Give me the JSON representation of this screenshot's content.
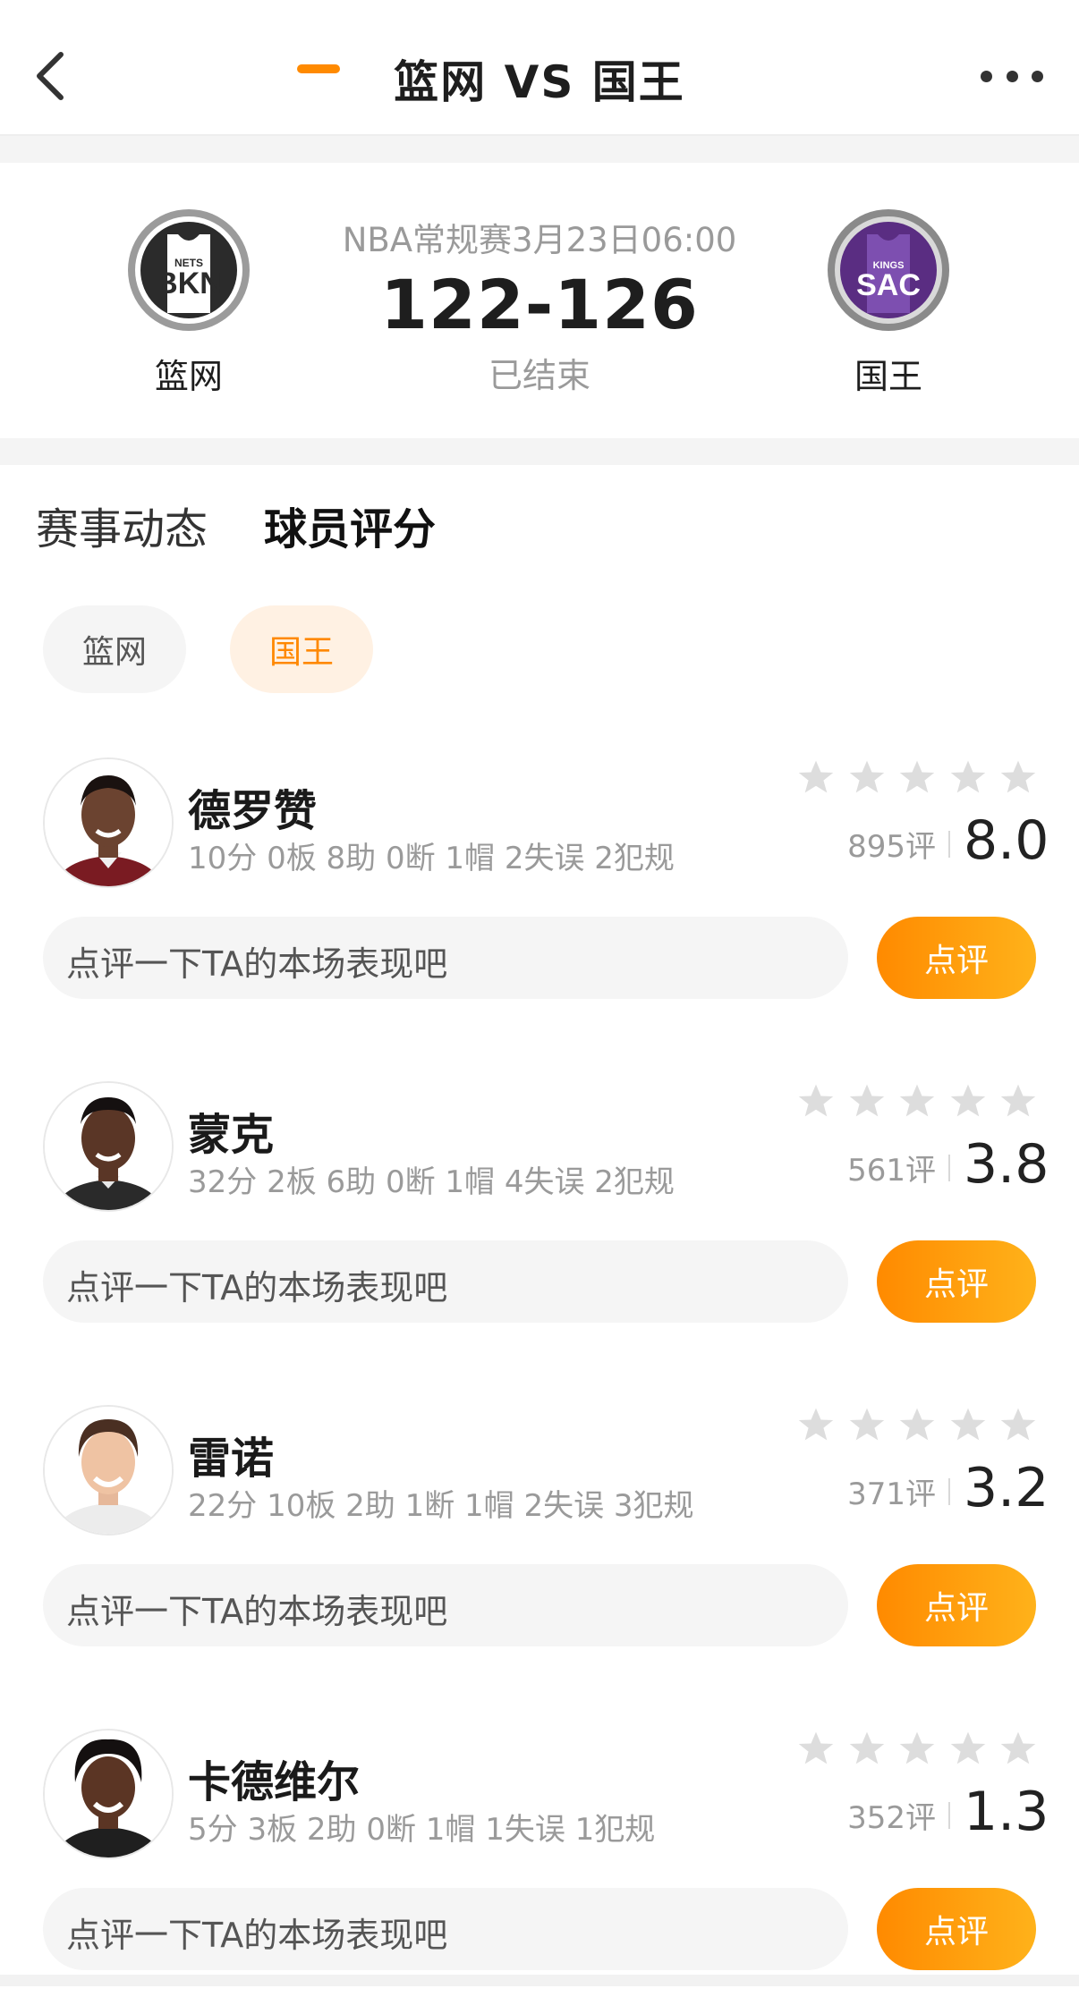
{
  "header": {
    "title": "篮网 VS 国王"
  },
  "match": {
    "meta": "NBA常规赛3月23日06:00",
    "score": "122-126",
    "status": "已结束",
    "home": {
      "name": "篮网",
      "logo_text_small": "NETS",
      "logo_text_big": "BKN"
    },
    "away": {
      "name": "国王",
      "logo_text_small": "KINGS",
      "logo_text_big": "SAC"
    }
  },
  "tabs": [
    {
      "label": "赛事动态"
    },
    {
      "label": "球员评分"
    }
  ],
  "active_tab": "球员评分",
  "team_filters": [
    {
      "label": "篮网"
    },
    {
      "label": "国王"
    }
  ],
  "active_team_filter": "国王",
  "players": [
    {
      "name": "德罗赞",
      "stats": "10分 0板 8助 0断 1帽 2失误 2犯规",
      "ratings_count": "895评",
      "score": "8.0",
      "comment_placeholder": "点评一下TA的本场表现吧",
      "button": "点评"
    },
    {
      "name": "蒙克",
      "stats": "32分 2板 6助 0断 1帽 4失误 2犯规",
      "ratings_count": "561评",
      "score": "3.8",
      "comment_placeholder": "点评一下TA的本场表现吧",
      "button": "点评"
    },
    {
      "name": "雷诺",
      "stats": "22分 10板 2助 1断 1帽 2失误 3犯规",
      "ratings_count": "371评",
      "score": "3.2",
      "comment_placeholder": "点评一下TA的本场表现吧",
      "button": "点评"
    },
    {
      "name": "卡德维尔",
      "stats": "5分 3板 2助 0断 1帽 1失误 1犯规",
      "ratings_count": "352评",
      "score": "1.3",
      "comment_placeholder": "点评一下TA的本场表现吧",
      "button": "点评"
    }
  ],
  "colors": {
    "accent": "#ff8a00",
    "nets": "#2b2b2b",
    "kings": "#5a2d82"
  }
}
